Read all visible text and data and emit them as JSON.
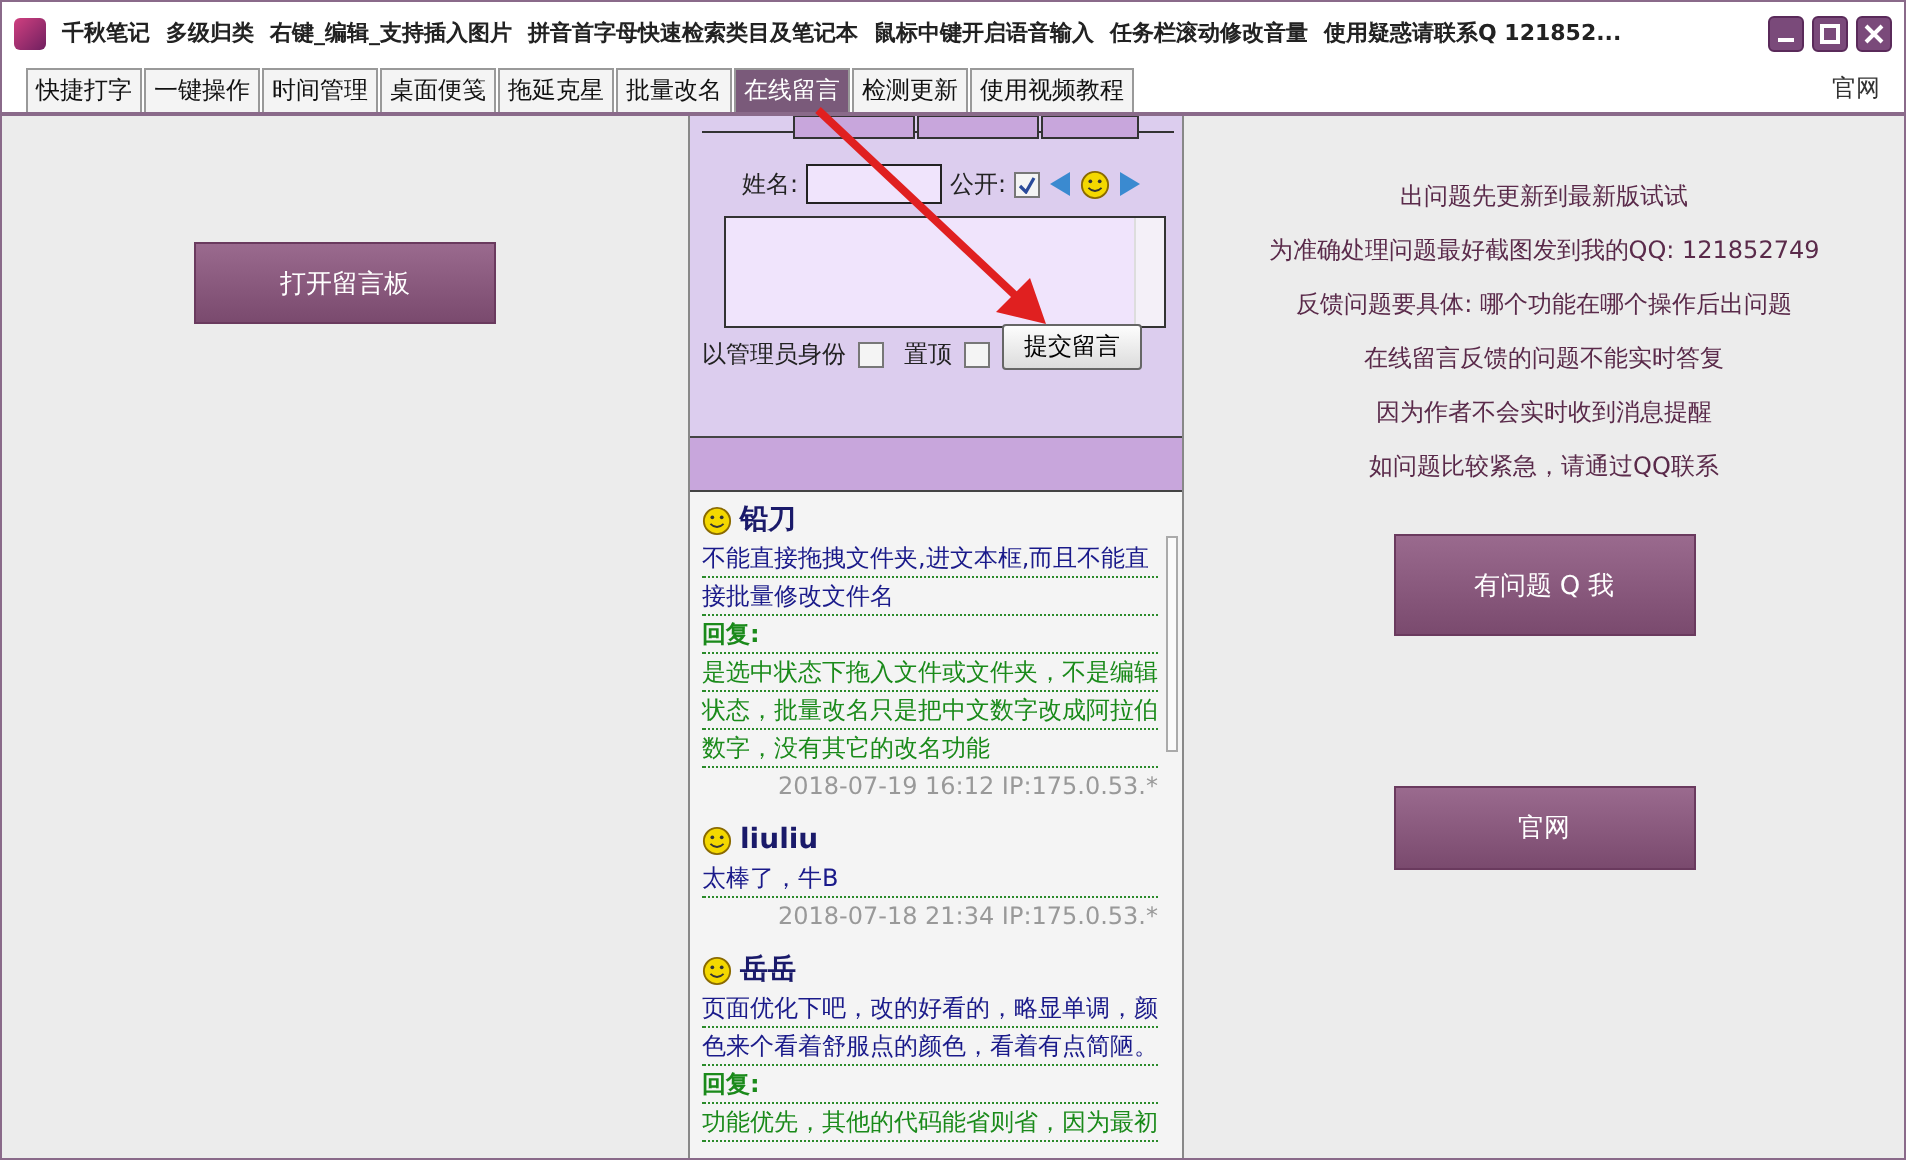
{
  "window": {
    "title_segments": [
      "千秋笔记",
      "多级归类",
      "右键_编辑_支持插入图片",
      "拼音首字母快速检索类目及笔记本",
      "鼠标中键开启语音输入",
      "任务栏滚动修改音量",
      "使用疑惑请联系Q 121852..."
    ]
  },
  "tabs": [
    {
      "label": "快捷打字",
      "selected": false
    },
    {
      "label": "一键操作",
      "selected": false
    },
    {
      "label": "时间管理",
      "selected": false
    },
    {
      "label": "桌面便笺",
      "selected": false
    },
    {
      "label": "拖延克星",
      "selected": false
    },
    {
      "label": "批量改名",
      "selected": false
    },
    {
      "label": "在线留言",
      "selected": true
    },
    {
      "label": "检测更新",
      "selected": false
    },
    {
      "label": "使用视频教程",
      "selected": false
    }
  ],
  "top_link": "官网",
  "left_panel": {
    "button": "打开留言板"
  },
  "form": {
    "name_label": "姓名:",
    "public_label": "公开:",
    "public_checked": true,
    "admin_label": "以管理员身份",
    "admin_checked": false,
    "pin_label": "置顶",
    "pin_checked": false,
    "submit": "提交留言"
  },
  "messages": [
    {
      "name": "铅刀",
      "body_lines": [
        "不能直接拖拽文件夹,进文本框,而且不能直",
        "接批量修改文件名"
      ],
      "reply_label": "回复:",
      "reply_lines": [
        "是选中状态下拖入文件或文件夹，不是编辑",
        "状态，批量改名只是把中文数字改成阿拉伯",
        "数字，没有其它的改名功能"
      ],
      "meta": "2018-07-19 16:12 IP:175.0.53.*"
    },
    {
      "name": "liuliu",
      "body_lines": [
        "太棒了，牛B"
      ],
      "meta": "2018-07-18 21:34 IP:175.0.53.*"
    },
    {
      "name": "岳岳",
      "body_lines": [
        "页面优化下吧，改的好看的，略显单调，颜",
        "色来个看着舒服点的颜色，看着有点简陋。"
      ],
      "reply_label": "回复:",
      "reply_lines": [
        "功能优先，其他的代码能省则省，因为最初"
      ]
    }
  ],
  "notices": [
    "出问题先更新到最新版试试",
    "为准确处理问题最好截图发到我的QQ: 121852749",
    "反馈问题要具体: 哪个功能在哪个操作后出问题",
    "在线留言反馈的问题不能实时答复",
    "因为作者不会实时收到消息提醒",
    "如问题比较紧急，请通过QQ联系"
  ],
  "right_buttons": [
    "有问题 Q 我",
    "官网"
  ]
}
